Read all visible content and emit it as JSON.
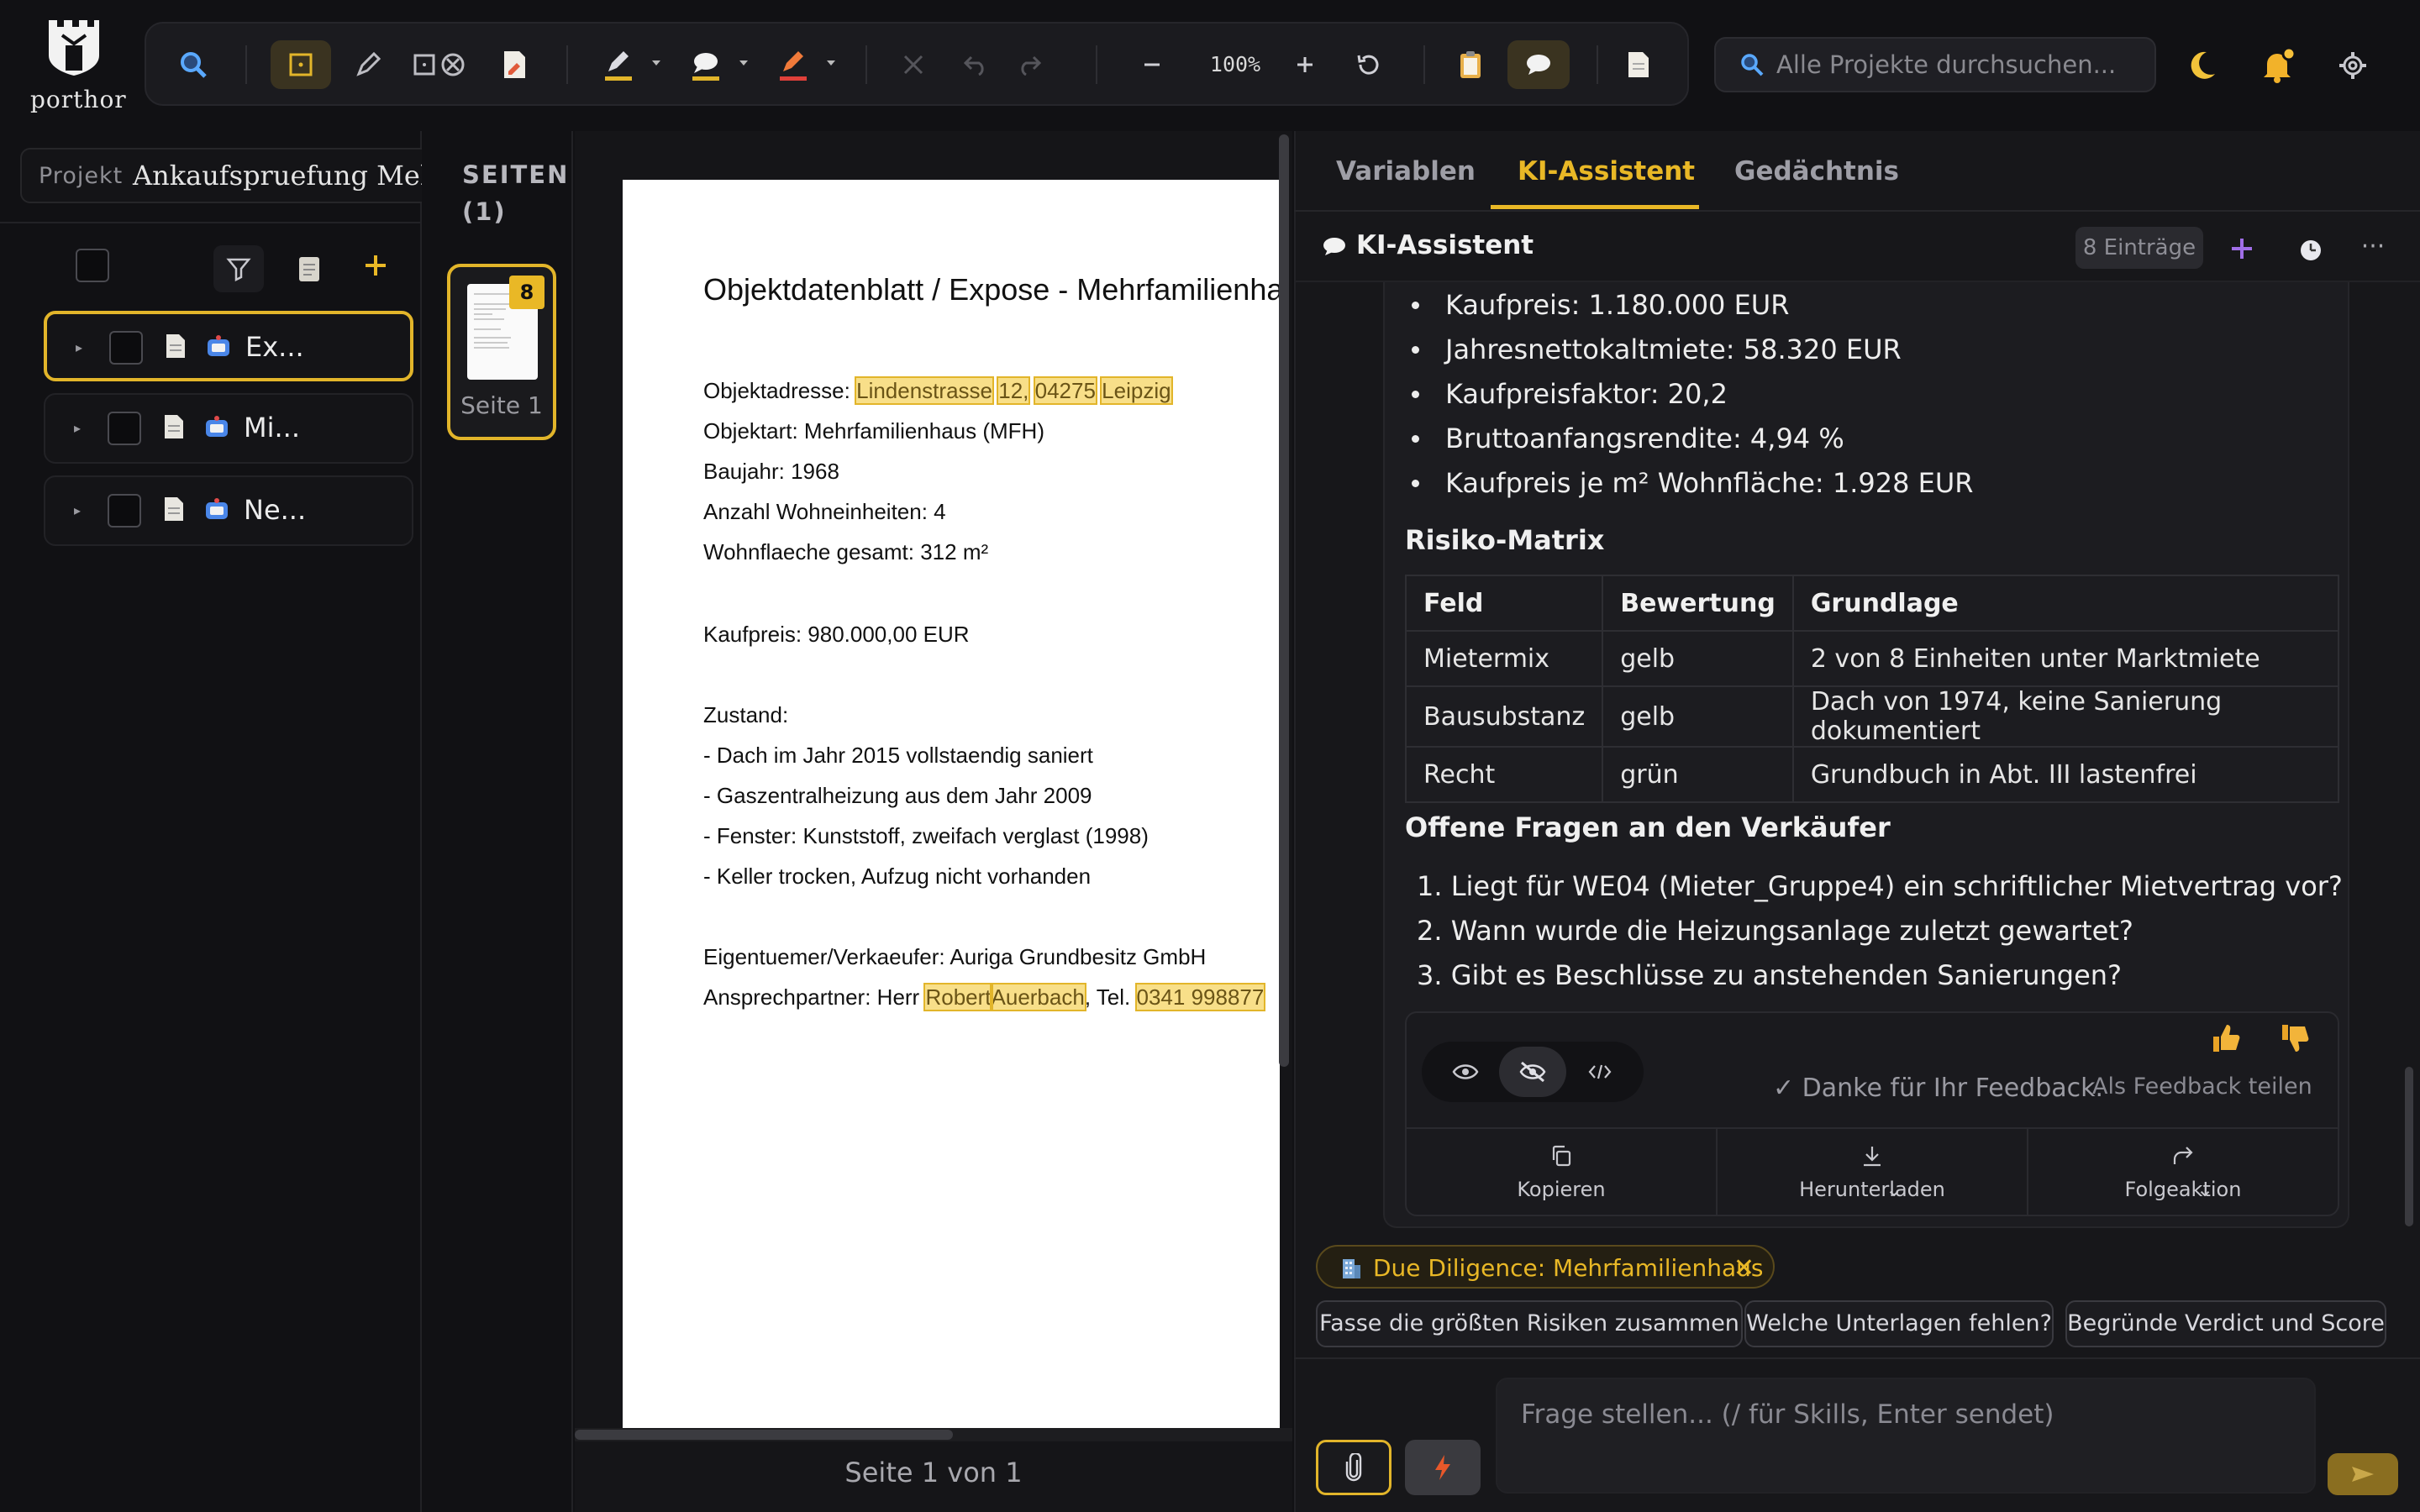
{
  "brand": {
    "name": "porthor"
  },
  "toolbar": {
    "zoom": "100%"
  },
  "search": {
    "placeholder": "Alle Projekte durchsuchen..."
  },
  "project": {
    "label": "Projekt",
    "name": "Ankaufspruefung Mehrfamilienhaus"
  },
  "files": [
    {
      "name": "Ex..."
    },
    {
      "name": "Mi..."
    },
    {
      "name": "Ne..."
    }
  ],
  "pages": {
    "title": "SEITEN (1)",
    "badge": "8",
    "thumb_label": "Seite 1"
  },
  "document": {
    "title": "Objektdatenblatt / Expose - Mehrfamilienhaus",
    "address_label": "Objektadresse:",
    "address_street": "Lindenstrasse",
    "address_no": "12,",
    "address_zip": "04275",
    "address_city": "Leipzig",
    "type": "Objektart: Mehrfamilienhaus (MFH)",
    "year": "Baujahr: 1968",
    "units": "Anzahl Wohneinheiten: 4",
    "area": "Wohnflaeche gesamt: 312 m²",
    "price": "Kaufpreis: 980.000,00 EUR",
    "state_head": "Zustand:",
    "state_1": "- Dach im Jahr 2015 vollstaendig saniert",
    "state_2": "- Gaszentralheizung aus dem Jahr 2009",
    "state_3": "- Fenster: Kunststoff, zweifach verglast (1998)",
    "state_4": "- Keller trocken, Aufzug nicht vorhanden",
    "owner": "Eigentuemer/Verkaeufer: Auriga Grundbesitz GmbH",
    "contact_label": "Ansprechpartner: Herr",
    "contact_first": "Robert",
    "contact_last": "Auerbach",
    "contact_tel_label": ", Tel.",
    "contact_tel": "0341 998877",
    "page_info": "Seite 1 von 1"
  },
  "right": {
    "tabs": [
      "Variablen",
      "KI-Assistent",
      "Gedächtnis"
    ],
    "chat_title": "KI-Assistent",
    "entries": "8 Einträge",
    "bullets": [
      "Kaufpreis: 1.180.000 EUR",
      "Jahresnettokaltmiete: 58.320 EUR",
      "Kaufpreisfaktor: 20,2",
      "Bruttoanfangsrendite: 4,94 %",
      "Kaufpreis je m² Wohnfläche: 1.928 EUR"
    ],
    "risk_title": "Risiko-Matrix",
    "risk_headers": [
      "Feld",
      "Bewertung",
      "Grundlage"
    ],
    "risk_rows": [
      [
        "Mietermix",
        "gelb",
        "2 von 8 Einheiten unter Marktmiete"
      ],
      [
        "Bausubstanz",
        "gelb",
        "Dach von 1974, keine Sanierung dokumentiert"
      ],
      [
        "Recht",
        "grün",
        "Grundbuch in Abt. III lastenfrei"
      ]
    ],
    "questions_title": "Offene Fragen an den Verkäufer",
    "questions": [
      "1. Liegt für WE04 (Mieter_Gruppe4) ein schriftlicher Mietvertrag vor?",
      "2. Wann wurde die Heizungsanlage zuletzt gewartet?",
      "3. Gibt es Beschlüsse zu anstehenden Sanierungen?"
    ],
    "feedback_thanks": "✓ Danke für Ihr Feedback.",
    "feedback_share": "Als Feedback teilen",
    "actions": [
      "Kopieren",
      "Herunterladen",
      "Folgeaktion"
    ],
    "context_chip": "Due Diligence: Mehrfamilienhaus",
    "suggestions": [
      "Fasse die größten Risiken zusammen",
      "Welche Unterlagen fehlen?",
      "Begründe Verdict und Score"
    ],
    "input_placeholder": "Frage stellen... (/ für Skills, Enter sendet)"
  },
  "colors": {
    "accent": "#e9b826",
    "background": "#111114",
    "panel": "#1c1c20"
  }
}
